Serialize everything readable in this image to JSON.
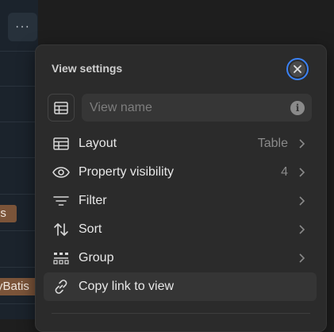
{
  "background": {
    "more_button_label": "···",
    "tags": [
      "is",
      "yBatis"
    ]
  },
  "panel": {
    "title": "View settings",
    "close_icon": "close-icon",
    "view_name_placeholder": "View name",
    "info_icon_glyph": "i",
    "items": [
      {
        "icon": "table-icon",
        "label": "Layout",
        "value": "Table"
      },
      {
        "icon": "eye-icon",
        "label": "Property visibility",
        "value": "4"
      },
      {
        "icon": "filter-icon",
        "label": "Filter",
        "value": ""
      },
      {
        "icon": "sort-icon",
        "label": "Sort",
        "value": ""
      },
      {
        "icon": "group-icon",
        "label": "Group",
        "value": ""
      },
      {
        "icon": "link-icon",
        "label": "Copy link to view",
        "value": ""
      }
    ]
  },
  "colors": {
    "accent": "#3b82f6",
    "tag_bg": "#7b5439",
    "panel_bg": "#2b2b2b"
  }
}
